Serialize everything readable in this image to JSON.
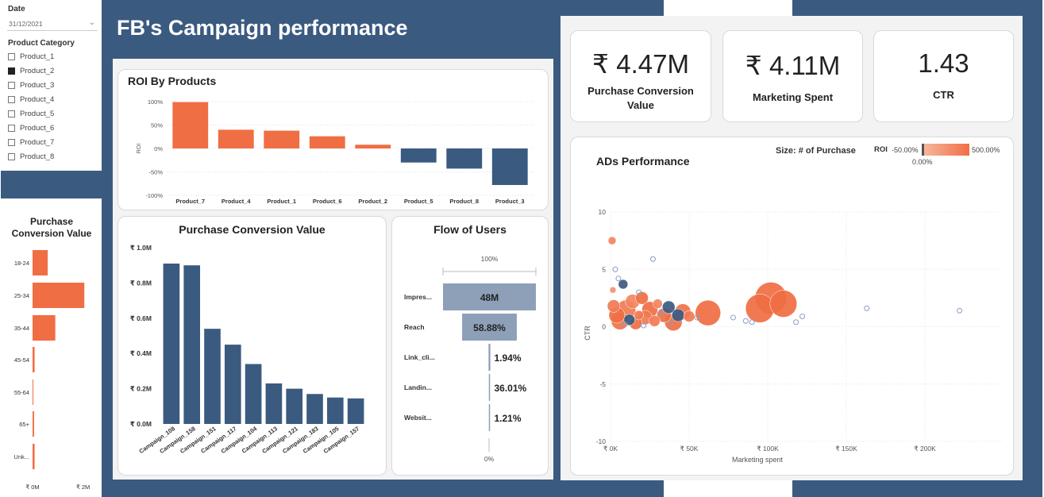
{
  "header": {
    "title": "FB's Campaign performance"
  },
  "filters": {
    "date_label": "Date",
    "date_value": "31/12/2021",
    "category_label": "Product Category",
    "categories": [
      {
        "label": "Product_1",
        "checked": false
      },
      {
        "label": "Product_2",
        "checked": true
      },
      {
        "label": "Product_3",
        "checked": false
      },
      {
        "label": "Product_4",
        "checked": false
      },
      {
        "label": "Product_5",
        "checked": false
      },
      {
        "label": "Product_6",
        "checked": false
      },
      {
        "label": "Product_7",
        "checked": false
      },
      {
        "label": "Product_8",
        "checked": false
      }
    ]
  },
  "kpis": {
    "purchase_value": "₹ 4.47M",
    "purchase_label": "Purchase Conversion Value",
    "spent_value": "₹ 4.11M",
    "spent_label": "Marketing Spent",
    "ctr_value": "1.43",
    "ctr_label": "CTR"
  },
  "colors": {
    "navy": "#3b5a80",
    "orange": "#f06e43",
    "funnel": "#8da0b8",
    "orange_light": "#f4a07f"
  },
  "chart_data": [
    {
      "id": "roi",
      "type": "bar",
      "title": "ROI By Products",
      "ylabel": "ROI",
      "yticks": [
        "100%",
        "50%",
        "0%",
        "-50%",
        "-100%"
      ],
      "ylim": [
        -100,
        100
      ],
      "categories": [
        "Product_7",
        "Product_4",
        "Product_1",
        "Product_6",
        "Product_2",
        "Product_5",
        "Product_8",
        "Product_3"
      ],
      "values": [
        99,
        40,
        38,
        26,
        8,
        -30,
        -43,
        -78
      ]
    },
    {
      "id": "age",
      "type": "bar",
      "orientation": "horizontal",
      "title": "Purchase Conversion Value",
      "categories": [
        "18-24",
        "25-34",
        "35-44",
        "45-54",
        "55-64",
        "65+",
        "Unk..."
      ],
      "values": [
        0.6,
        2.05,
        0.9,
        0.08,
        0.02,
        0.06,
        0.08
      ],
      "xticks": [
        "₹ 0M",
        "₹ 2M"
      ],
      "xlim": [
        0,
        2.2
      ]
    },
    {
      "id": "campaign",
      "type": "bar",
      "title": "Purchase Conversion Value",
      "yticks": [
        "₹ 1.0M",
        "₹ 0.8M",
        "₹ 0.6M",
        "₹ 0.4M",
        "₹ 0.2M",
        "₹ 0.0M"
      ],
      "ylim": [
        0,
        1.0
      ],
      "categories": [
        "Campaign_108",
        "Campaign_158",
        "Campaign_151",
        "Campaign_117",
        "Campaign_104",
        "Campaign_113",
        "Campaign_121",
        "Campaign_183",
        "Campaign_105",
        "Campaign_157"
      ],
      "values": [
        0.91,
        0.9,
        0.54,
        0.45,
        0.34,
        0.23,
        0.2,
        0.17,
        0.15,
        0.145
      ]
    },
    {
      "id": "funnel",
      "type": "funnel",
      "title": "Flow of Users",
      "top_label": "100%",
      "bottom_label": "0%",
      "stages": [
        {
          "label": "Impres...",
          "text": "48M",
          "fraction": 1.0
        },
        {
          "label": "Reach",
          "text": "58.88%",
          "fraction": 0.5888
        },
        {
          "label": "Link_cli...",
          "text": "1.94%",
          "fraction": 0.0194
        },
        {
          "label": "Landin...",
          "text": "36.01%",
          "fraction": 0.0069
        },
        {
          "label": "Websit...",
          "text": "1.21%",
          "fraction": 0.0001
        }
      ]
    },
    {
      "id": "ads",
      "type": "scatter",
      "title": "ADs Performance",
      "xlabel": "Marketing spent",
      "ylabel": "CTR",
      "xlim": [
        0,
        250000
      ],
      "ylim": [
        -10,
        10
      ],
      "xticks": [
        {
          "v": 0,
          "t": "₹ 0K"
        },
        {
          "v": 50000,
          "t": "₹ 50K"
        },
        {
          "v": 100000,
          "t": "₹ 100K"
        },
        {
          "v": 150000,
          "t": "₹ 150K"
        },
        {
          "v": 200000,
          "t": "₹ 200K"
        }
      ],
      "yticks": [
        10,
        5,
        0,
        -5,
        -10
      ],
      "legend_size": "Size: # of Purchase",
      "legend_roi": "ROI",
      "legend_min": "-50.00%",
      "legend_mid": "0.00%",
      "legend_max": "500.00%",
      "points": [
        {
          "x": 1000,
          "y": 7.5,
          "r": 5,
          "roi": 200
        },
        {
          "x": 1500,
          "y": 3.2,
          "r": 4,
          "roi": 150
        },
        {
          "x": 2000,
          "y": 1.8,
          "r": 8,
          "roi": 250
        },
        {
          "x": 4000,
          "y": 1.0,
          "r": 10,
          "roi": 300
        },
        {
          "x": 6000,
          "y": 0.5,
          "r": 11,
          "roi": 280
        },
        {
          "x": 8000,
          "y": 3.7,
          "r": 6,
          "roi": -50
        },
        {
          "x": 10000,
          "y": 1.5,
          "r": 12,
          "roi": 250
        },
        {
          "x": 12000,
          "y": 0.6,
          "r": 7,
          "roi": -50
        },
        {
          "x": 14000,
          "y": 2.2,
          "r": 9,
          "roi": 200
        },
        {
          "x": 16000,
          "y": 0.3,
          "r": 8,
          "roi": 300
        },
        {
          "x": 18000,
          "y": 1.0,
          "r": 6,
          "roi": 250
        },
        {
          "x": 20000,
          "y": 2.5,
          "r": 8,
          "roi": 300
        },
        {
          "x": 22000,
          "y": 0.8,
          "r": 9,
          "roi": 250
        },
        {
          "x": 25000,
          "y": 1.5,
          "r": 10,
          "roi": 300
        },
        {
          "x": 28000,
          "y": 0.5,
          "r": 7,
          "roi": 250
        },
        {
          "x": 30000,
          "y": 2.0,
          "r": 6,
          "roi": 200
        },
        {
          "x": 34000,
          "y": 1.0,
          "r": 9,
          "roi": 300
        },
        {
          "x": 37000,
          "y": 1.7,
          "r": 8,
          "roi": -50
        },
        {
          "x": 40000,
          "y": 0.4,
          "r": 11,
          "roi": 300
        },
        {
          "x": 43000,
          "y": 1.0,
          "r": 8,
          "roi": -40
        },
        {
          "x": 46000,
          "y": 1.3,
          "r": 10,
          "roi": 280
        },
        {
          "x": 50000,
          "y": 0.9,
          "r": 7,
          "roi": 250
        },
        {
          "x": 62000,
          "y": 1.2,
          "r": 16,
          "roi": 300
        },
        {
          "x": 95000,
          "y": 1.6,
          "r": 18,
          "roi": 300
        },
        {
          "x": 102000,
          "y": 2.5,
          "r": 20,
          "roi": 300
        },
        {
          "x": 110000,
          "y": 2.0,
          "r": 17,
          "roi": 300
        },
        {
          "x": 3000,
          "y": 5.0,
          "r": 3,
          "roi": 0,
          "hollow": true
        },
        {
          "x": 27000,
          "y": 5.9,
          "r": 3,
          "roi": 0,
          "hollow": true
        },
        {
          "x": 18000,
          "y": 3.0,
          "r": 3,
          "roi": 0,
          "hollow": true
        },
        {
          "x": 5000,
          "y": 4.2,
          "r": 3,
          "roi": 0,
          "hollow": true
        },
        {
          "x": 32000,
          "y": 1.2,
          "r": 3,
          "roi": 0,
          "hollow": true
        },
        {
          "x": 38000,
          "y": 0.3,
          "r": 3,
          "roi": 0,
          "hollow": true
        },
        {
          "x": 55000,
          "y": 0.8,
          "r": 3,
          "roi": 0,
          "hollow": true
        },
        {
          "x": 78000,
          "y": 0.8,
          "r": 3,
          "roi": 0,
          "hollow": true
        },
        {
          "x": 86000,
          "y": 0.5,
          "r": 3,
          "roi": 0,
          "hollow": true
        },
        {
          "x": 90000,
          "y": 0.4,
          "r": 3,
          "roi": 0,
          "hollow": true
        },
        {
          "x": 118000,
          "y": 0.4,
          "r": 3,
          "roi": 0,
          "hollow": true
        },
        {
          "x": 122000,
          "y": 0.9,
          "r": 3,
          "roi": 0,
          "hollow": true
        },
        {
          "x": 163000,
          "y": 1.6,
          "r": 3,
          "roi": 0,
          "hollow": true
        },
        {
          "x": 222000,
          "y": 1.4,
          "r": 3,
          "roi": 0,
          "hollow": true
        },
        {
          "x": 9000,
          "y": 0.2,
          "r": 3,
          "roi": 0,
          "hollow": true
        },
        {
          "x": 21000,
          "y": 0.1,
          "r": 3,
          "roi": 0,
          "hollow": true
        }
      ]
    }
  ]
}
